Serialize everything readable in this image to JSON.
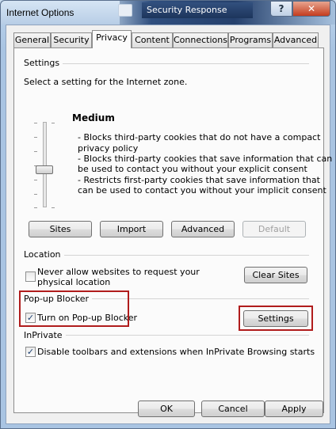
{
  "window": {
    "title": "Internet Options",
    "help_label": "?",
    "close_label": "✕"
  },
  "background": {
    "tab_title": "Security Response"
  },
  "tabs": [
    "General",
    "Security",
    "Privacy",
    "Content",
    "Connections",
    "Programs",
    "Advanced"
  ],
  "active_tab": "Privacy",
  "settings": {
    "heading": "Settings",
    "instruction": "Select a setting for the Internet zone.",
    "level": "Medium",
    "description_lines": [
      "- Blocks third-party cookies that do not have a compact",
      "privacy policy",
      "- Blocks third-party cookies that save information that can",
      "be used to contact you without your explicit consent",
      "- Restricts first-party cookies that save information that",
      "can be used to contact you without your implicit consent"
    ],
    "buttons": {
      "sites": "Sites",
      "import": "Import",
      "advanced": "Advanced",
      "default": "Default"
    }
  },
  "location": {
    "heading": "Location",
    "checkbox_line1": "Never allow websites to request your",
    "checkbox_line2": "physical location",
    "checked": false,
    "clear_sites": "Clear Sites"
  },
  "popup": {
    "heading": "Pop-up Blocker",
    "checkbox_label": "Turn on Pop-up Blocker",
    "checked": true,
    "settings_button": "Settings"
  },
  "inprivate": {
    "heading": "InPrivate",
    "checkbox_label": "Disable toolbars and extensions when InPrivate Browsing starts",
    "checked": true
  },
  "footer": {
    "ok": "OK",
    "cancel": "Cancel",
    "apply": "Apply"
  },
  "colors": {
    "highlight_box": "#b01c1c",
    "check_mark": "#1a3e70"
  }
}
